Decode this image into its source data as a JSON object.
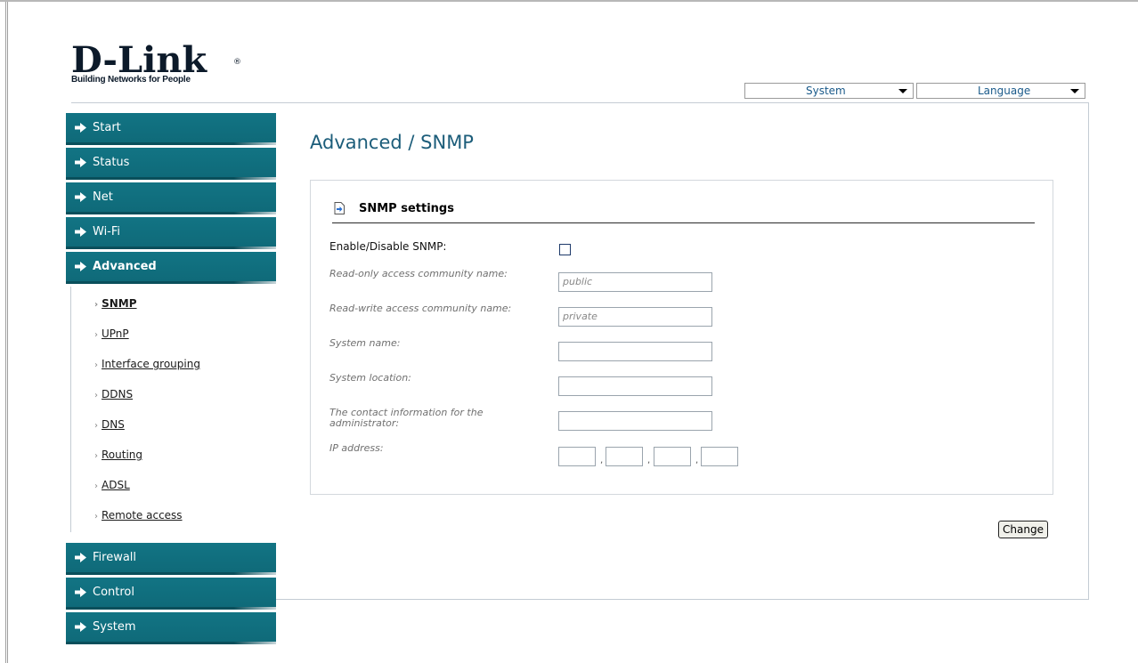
{
  "logo": {
    "brand": "D-Link",
    "registered": "®",
    "tagline": "Building Networks for People"
  },
  "top_menu": {
    "system_label": "System",
    "language_label": "Language"
  },
  "sidebar": {
    "items": [
      {
        "label": "Start"
      },
      {
        "label": "Status"
      },
      {
        "label": "Net"
      },
      {
        "label": "Wi-Fi"
      },
      {
        "label": "Advanced"
      },
      {
        "label": "Firewall"
      },
      {
        "label": "Control"
      },
      {
        "label": "System"
      }
    ],
    "advanced_subitems": [
      {
        "label": "SNMP"
      },
      {
        "label": "UPnP"
      },
      {
        "label": "Interface grouping"
      },
      {
        "label": "DDNS"
      },
      {
        "label": "DNS"
      },
      {
        "label": "Routing"
      },
      {
        "label": "ADSL"
      },
      {
        "label": "Remote access"
      }
    ],
    "bullet": "›"
  },
  "page": {
    "title": "Advanced / SNMP"
  },
  "snmp": {
    "section_title": "SNMP settings",
    "enable_label": "Enable/Disable SNMP:",
    "read_only_label": "Read-only access community name:",
    "read_only_value": "public",
    "read_write_label": "Read-write access community name:",
    "read_write_value": "private",
    "system_name_label": "System name:",
    "system_location_label": "System location:",
    "contact_label": "The contact information for the administrator:",
    "ip_label": "IP address:",
    "ip_separator": ","
  },
  "actions": {
    "change_label": "Change"
  },
  "colors": {
    "nav_bg": "#127484",
    "title": "#1c5d7a"
  }
}
